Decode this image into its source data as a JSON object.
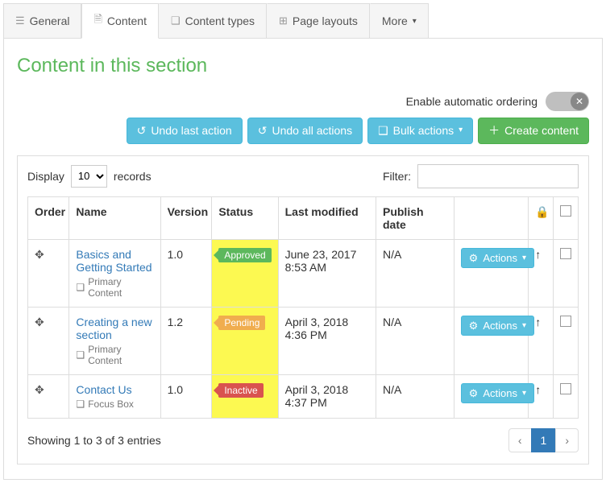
{
  "tabs": {
    "general": "General",
    "content": "Content",
    "content_types": "Content types",
    "page_layouts": "Page layouts",
    "more": "More"
  },
  "page_title": "Content in this section",
  "ordering_label": "Enable automatic ordering",
  "buttons": {
    "undo_last": "Undo last action",
    "undo_all": "Undo all actions",
    "bulk": "Bulk actions",
    "create": "Create content",
    "actions": "Actions"
  },
  "toolbar": {
    "display": "Display",
    "records": "records",
    "page_size": "10",
    "filter_label": "Filter:",
    "filter_value": ""
  },
  "columns": {
    "order": "Order",
    "name": "Name",
    "version": "Version",
    "status": "Status",
    "last_modified": "Last modified",
    "publish_date": "Publish date"
  },
  "rows": [
    {
      "name": "Basics and Getting Started",
      "subtype": "Primary Content",
      "version": "1.0",
      "status_label": "Approved",
      "status_kind": "approved",
      "last_modified": "June 23, 2017 8:53 AM",
      "publish_date": "N/A"
    },
    {
      "name": "Creating a new section",
      "subtype": "Primary Content",
      "version": "1.2",
      "status_label": "Pending",
      "status_kind": "pending",
      "last_modified": "April 3, 2018 4:36 PM",
      "publish_date": "N/A"
    },
    {
      "name": "Contact Us",
      "subtype": "Focus Box",
      "version": "1.0",
      "status_label": "Inactive",
      "status_kind": "inactive",
      "last_modified": "April 3, 2018 4:37 PM",
      "publish_date": "N/A"
    }
  ],
  "footer": {
    "showing": "Showing 1 to 3 of 3 entries",
    "current_page": "1"
  }
}
